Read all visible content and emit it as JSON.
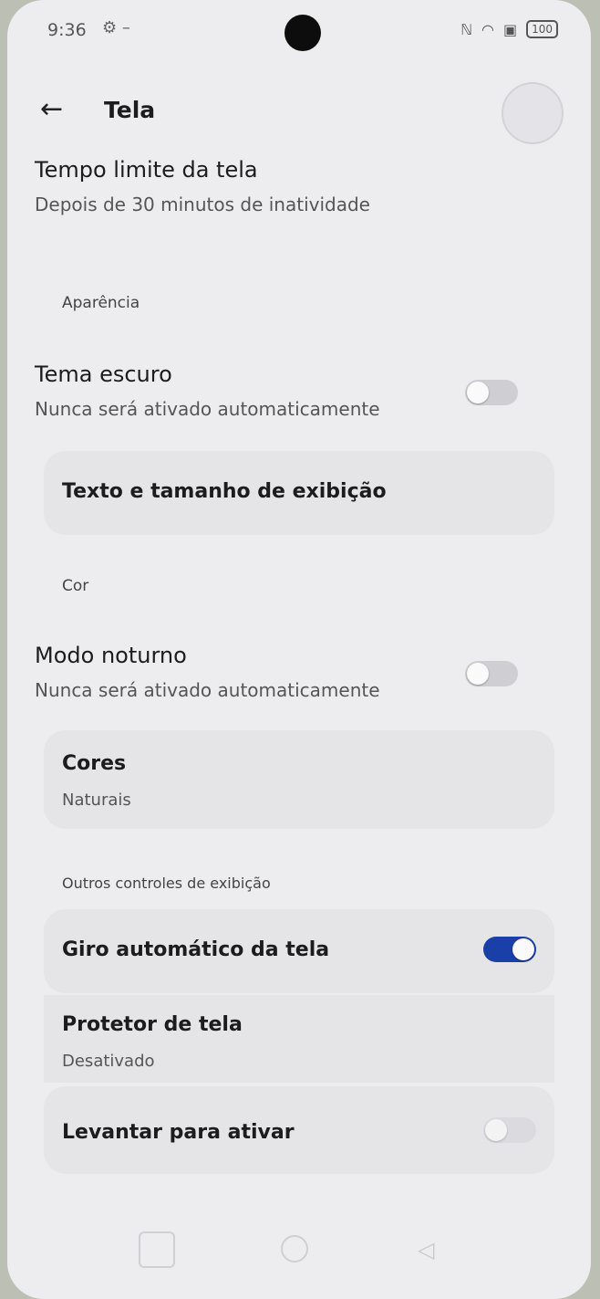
{
  "status_bar": {
    "time": "9:36",
    "battery": "100"
  },
  "header": {
    "title": "Tela"
  },
  "screen_timeout": {
    "title": "Tempo limite da tela",
    "subtitle": "Depois de 30 minutos de inatividade"
  },
  "section_appearance": "Aparência",
  "dark_theme": {
    "title": "Tema escuro",
    "subtitle": "Nunca será ativado automaticamente",
    "enabled": false
  },
  "text_size": {
    "title": "Texto e tamanho de exibição"
  },
  "section_color": "Cor",
  "night_mode": {
    "title": "Modo noturno",
    "subtitle": "Nunca será ativado automaticamente",
    "enabled": false
  },
  "colors": {
    "title": "Cores",
    "subtitle": "Naturais"
  },
  "section_other": "Outros controles de exibição",
  "auto_rotate": {
    "title": "Giro automático da tela",
    "enabled": true
  },
  "screensaver": {
    "title": "Protetor de tela",
    "subtitle": "Desativado"
  },
  "lift_to_wake": {
    "title": "Levantar para ativar",
    "enabled": false
  },
  "colors_theme": {
    "toggle_on": "#1b3fa8",
    "toggle_off": "#cfcfd3",
    "background": "#ededf0"
  }
}
